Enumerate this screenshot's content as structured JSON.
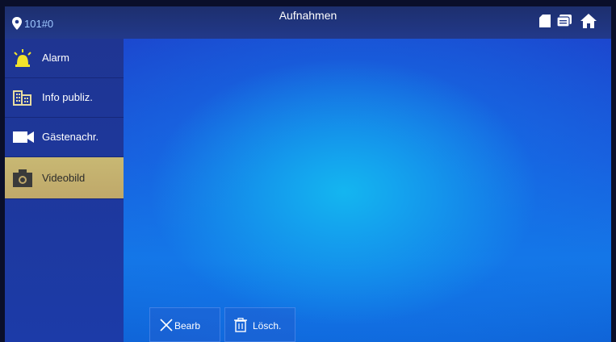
{
  "header": {
    "location": "101#0",
    "title": "Aufnahmen",
    "icons": [
      "sd-card-icon",
      "message-icon",
      "home-icon"
    ]
  },
  "sidebar": {
    "items": [
      {
        "label": "Alarm",
        "icon": "alarm-icon",
        "active": false
      },
      {
        "label": "Info publiz.",
        "icon": "info-building-icon",
        "active": false
      },
      {
        "label": "Gästenachr.",
        "icon": "video-camera-icon",
        "active": false
      },
      {
        "label": "Videobild",
        "icon": "photo-camera-icon",
        "active": true
      }
    ]
  },
  "toolbar": {
    "edit_label": "Bearb",
    "delete_label": "Lösch."
  },
  "colors": {
    "active_tab": "#c8b873",
    "background": "#1a59db"
  }
}
